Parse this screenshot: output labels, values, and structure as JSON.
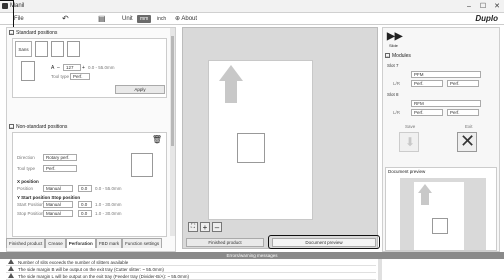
{
  "window": {
    "title": "Manil",
    "controls": [
      "–",
      "☐",
      "✕"
    ]
  },
  "menubar": {
    "file": "File",
    "unit_label": "Unit",
    "unit_mm": "mm",
    "unit_inch": "inch",
    "about": "About",
    "brand": "Duplo"
  },
  "standard": {
    "header": "Standard positions",
    "tab": "Sans",
    "a_label": "A",
    "a_value": "127",
    "a_range": "0.0 - 55.0mm",
    "tool_label": "Tool type",
    "tool_value": "Perf.",
    "apply": "Apply"
  },
  "nonstandard": {
    "header": "Non-standard positions",
    "direction_label": "Direction",
    "direction_value": "Rotary perf.",
    "tooltype_label": "Tool type",
    "tooltype_value": "Perf.",
    "xpos_header": "X position",
    "x_position_label": "Position",
    "x_position_mode": "Manual",
    "x_position_value": "0.0",
    "x_position_range": "0.0 - 55.0mm",
    "y_header": "Y Start position Stop position",
    "y_start_label": "Start Position",
    "y_start_mode": "Manual",
    "y_start_value": "0.0",
    "y_start_range": "1.0 - 30.0mm",
    "y_stop_label": "Stop Position",
    "y_stop_mode": "Manual",
    "y_stop_value": "0.0",
    "y_stop_range": "1.0 - 30.0mm"
  },
  "tabs": [
    "Finished product",
    "Crease",
    "Perforation",
    "FBD mark",
    "Function settings"
  ],
  "center": {
    "finished_btn": "Finished product",
    "preview_btn": "Document preview",
    "zoom_in": "+",
    "zoom_out": "–"
  },
  "right": {
    "slide_label": "Slide",
    "modules_header": "Modules",
    "slot1": "Slot 7",
    "slot1_row1": "PFM",
    "slot1_lr_label": "L/R",
    "slot1_left": "Perf.",
    "slot1_right": "Perf.",
    "slot2": "Slot 8",
    "slot2_row1": "RFM",
    "slot2_lr_label": "L/R",
    "slot2_left": "Perf.",
    "slot2_right": "Perf.",
    "save_label": "Save",
    "exit_label": "Exit",
    "docpreview_header": "Document preview"
  },
  "messages": {
    "header": "Errors/warning messages",
    "items": [
      "Number of slits exceeds the number of slitters available",
      "The side margin B will be output on the exit tray (Cutter slitter: ~ 55.0mm)",
      "The side margin L will be output on the exit tray (Feeder tray (Divider-B/A): ~ 55.0mm)"
    ]
  },
  "colors": {
    "accent": "#111111",
    "panel": "#fafafa",
    "preview_bg": "#d9d9d9",
    "arrow": "#c8c8c8"
  }
}
